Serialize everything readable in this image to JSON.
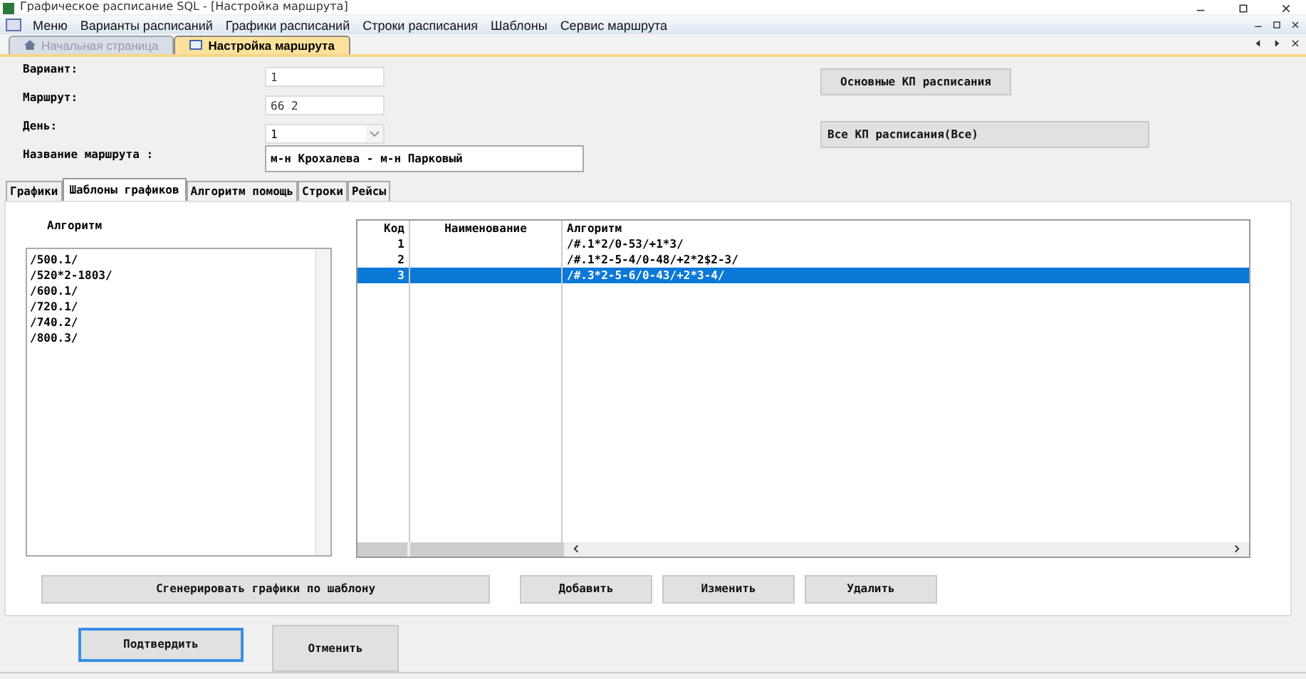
{
  "window": {
    "title": "Графическое расписание SQL - [Настройка маршрута]"
  },
  "menu": [
    "Меню",
    "Варианты расписаний",
    "Графики расписаний",
    "Строки расписания",
    "Шаблоны",
    "Сервис маршрута"
  ],
  "doc_tabs": [
    {
      "label": "Начальная страница",
      "selected": false
    },
    {
      "label": "Настройка маршрута",
      "selected": true
    }
  ],
  "form": {
    "fields": [
      {
        "label": "Вариант:",
        "value": "1",
        "kind": "text"
      },
      {
        "label": "Маршрут:",
        "value": "66  2",
        "kind": "text"
      },
      {
        "label": "День:",
        "value": "1",
        "kind": "combo"
      },
      {
        "label": "Название маршрута :",
        "value": "м-н Крохалева - м-н Парковый",
        "kind": "wide"
      }
    ],
    "side_buttons": [
      "Основные КП расписания",
      "Все КП расписания(Все)"
    ]
  },
  "tabs": [
    {
      "label": "Графики",
      "selected": false
    },
    {
      "label": "Шаблоны графиков",
      "selected": true
    },
    {
      "label": "Алгоритм помощь",
      "selected": false
    },
    {
      "label": "Строки",
      "selected": false
    },
    {
      "label": "Рейсы",
      "selected": false
    }
  ],
  "algorithm_list": {
    "title": "Алгоритм",
    "items": [
      "/500.1/",
      "/520*2-1803/",
      "/600.1/",
      "/720.1/",
      "/740.2/",
      "/800.3/"
    ]
  },
  "table": {
    "columns": [
      "Код",
      "Наименование",
      "Алгоритм"
    ],
    "rows": [
      {
        "cells": [
          "1",
          "",
          "/#.1*2/0-53/+1*3/"
        ],
        "selected": false
      },
      {
        "cells": [
          "2",
          "",
          "/#.1*2-5-4/0-48/+2*2$2-3/"
        ],
        "selected": false
      },
      {
        "cells": [
          "3",
          "",
          "/#.3*2-5-6/0-43/+2*3-4/"
        ],
        "selected": true
      }
    ]
  },
  "panel_buttons": [
    "Сгенерировать графики по шаблону",
    "Добавить",
    "Изменить",
    "Удалить"
  ],
  "dialog_buttons": [
    {
      "label": "Подтвердить",
      "selected": true
    },
    {
      "label": "Отменить",
      "selected": false
    }
  ]
}
